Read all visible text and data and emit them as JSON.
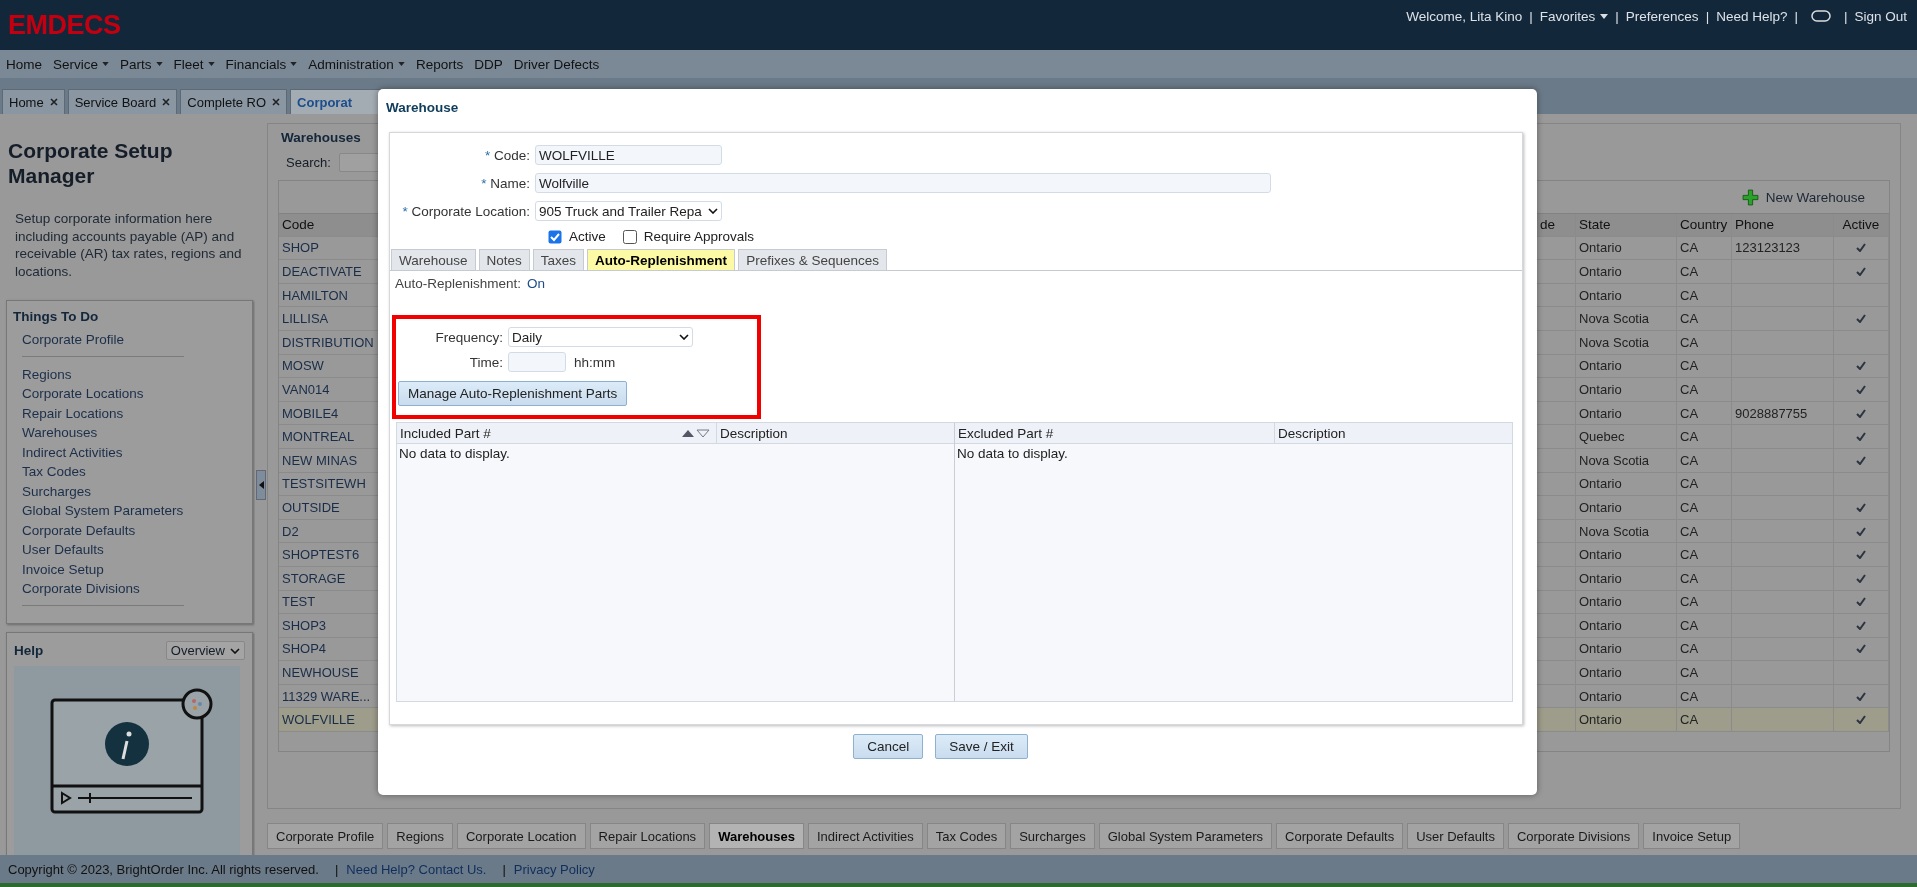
{
  "header": {
    "logo": "EMDECS",
    "items": [
      {
        "kind": "text",
        "label": "Welcome, Lita Kino"
      },
      {
        "kind": "sep",
        "label": "|"
      },
      {
        "kind": "dropdown",
        "label": "Favorites"
      },
      {
        "kind": "sep",
        "label": "|"
      },
      {
        "kind": "link",
        "label": "Preferences"
      },
      {
        "kind": "sep",
        "label": "|"
      },
      {
        "kind": "link",
        "label": "Need Help?"
      },
      {
        "kind": "sep",
        "label": "|"
      },
      {
        "kind": "icon"
      },
      {
        "kind": "sep",
        "label": "|"
      },
      {
        "kind": "link",
        "label": "Sign Out"
      }
    ]
  },
  "menu": [
    {
      "label": "Home",
      "dropdown": false
    },
    {
      "label": "Service",
      "dropdown": true
    },
    {
      "label": "Parts",
      "dropdown": true
    },
    {
      "label": "Fleet",
      "dropdown": true
    },
    {
      "label": "Financials",
      "dropdown": true
    },
    {
      "label": "Administration",
      "dropdown": true
    },
    {
      "label": "Reports",
      "dropdown": false
    },
    {
      "label": "DDP",
      "dropdown": false
    },
    {
      "label": "Driver Defects",
      "dropdown": false
    }
  ],
  "tabs": [
    {
      "label": "Home",
      "selected": false,
      "closable": true
    },
    {
      "label": "Service Board",
      "selected": false,
      "closable": true
    },
    {
      "label": "Complete RO",
      "selected": false,
      "closable": true
    },
    {
      "label": "Corporat",
      "selected": true,
      "closable": false
    }
  ],
  "sidebar": {
    "title": "Corporate Setup Manager",
    "description": "Setup corporate information here including accounts payable (AP) and receivable (AR) tax rates, regions and locations.",
    "things_to_do": {
      "title": "Things To Do",
      "groups": [
        [
          "Corporate Profile"
        ],
        [
          "Regions",
          "Corporate Locations",
          "Repair Locations",
          "Warehouses",
          "Indirect Activities",
          "Tax Codes",
          "Surcharges",
          "Global System Parameters",
          "Corporate Defaults",
          "User Defaults",
          "Invoice Setup",
          "Corporate Divisions"
        ]
      ]
    },
    "help": {
      "title": "Help",
      "dropdown": "Overview"
    }
  },
  "warehouses": {
    "title": "Warehouses",
    "search_label": "Search:",
    "new_button": "New Warehouse",
    "columns": [
      "Code",
      "de",
      "State",
      "Country",
      "Phone",
      "Active"
    ],
    "rows": [
      {
        "code": "SHOP",
        "state": "Ontario",
        "country": "CA",
        "phone": "123123123",
        "active": true,
        "selected": false
      },
      {
        "code": "DEACTIVATE",
        "state": "Ontario",
        "country": "CA",
        "active": true,
        "selected": false
      },
      {
        "code": "HAMILTON",
        "state": "Ontario",
        "country": "CA",
        "active": false,
        "selected": false
      },
      {
        "code": "LILLISA",
        "state": "Nova Scotia",
        "country": "CA",
        "active": true,
        "selected": false
      },
      {
        "code": "DISTRIBUTION",
        "state": "Nova Scotia",
        "country": "CA",
        "active": false,
        "selected": false
      },
      {
        "code": "MOSW",
        "state": "Ontario",
        "country": "CA",
        "active": true,
        "selected": false
      },
      {
        "code": "VAN014",
        "state": "Ontario",
        "country": "CA",
        "active": true,
        "selected": false
      },
      {
        "code": "MOBILE4",
        "state": "Ontario",
        "country": "CA",
        "phone": "9028887755",
        "active": true,
        "selected": false
      },
      {
        "code": "MONTREAL",
        "state": "Quebec",
        "country": "CA",
        "active": true,
        "selected": false
      },
      {
        "code": "NEW MINAS",
        "state": "Nova Scotia",
        "country": "CA",
        "active": true,
        "selected": false
      },
      {
        "code": "TESTSITEWH",
        "state": "Ontario",
        "country": "CA",
        "active": false,
        "selected": false
      },
      {
        "code": "OUTSIDE",
        "state": "Ontario",
        "country": "CA",
        "active": true,
        "selected": false
      },
      {
        "code": "D2",
        "state": "Nova Scotia",
        "country": "CA",
        "active": true,
        "selected": false
      },
      {
        "code": "SHOPTEST6",
        "state": "Ontario",
        "country": "CA",
        "active": true,
        "selected": false
      },
      {
        "code": "STORAGE",
        "state": "Ontario",
        "country": "CA",
        "active": true,
        "selected": false
      },
      {
        "code": "TEST",
        "state": "Ontario",
        "country": "CA",
        "active": true,
        "selected": false
      },
      {
        "code": "SHOP3",
        "state": "Ontario",
        "country": "CA",
        "active": true,
        "selected": false
      },
      {
        "code": "SHOP4",
        "state": "Ontario",
        "country": "CA",
        "active": true,
        "selected": false
      },
      {
        "code": "NEWHOUSE",
        "state": "Ontario",
        "country": "CA",
        "active": false,
        "selected": false
      },
      {
        "code": "11329 WARE...",
        "state": "Ontario",
        "country": "CA",
        "active": true,
        "selected": false
      },
      {
        "code": "WOLFVILLE",
        "state": "Ontario",
        "country": "CA",
        "active": true,
        "selected": true
      }
    ]
  },
  "bottom_tabs": [
    {
      "label": "Corporate Profile",
      "selected": false
    },
    {
      "label": "Regions",
      "selected": false
    },
    {
      "label": "Corporate Location",
      "selected": false
    },
    {
      "label": "Repair Locations",
      "selected": false
    },
    {
      "label": "Warehouses",
      "selected": true
    },
    {
      "label": "Indirect Activities",
      "selected": false
    },
    {
      "label": "Tax Codes",
      "selected": false
    },
    {
      "label": "Surcharges",
      "selected": false
    },
    {
      "label": "Global System Parameters",
      "selected": false
    },
    {
      "label": "Corporate Defaults",
      "selected": false
    },
    {
      "label": "User Defaults",
      "selected": false
    },
    {
      "label": "Corporate Divisions",
      "selected": false
    },
    {
      "label": "Invoice Setup",
      "selected": false
    }
  ],
  "footer": [
    {
      "kind": "text",
      "label": "Copyright © 2023, BrightOrder Inc. All rights reserved."
    },
    {
      "kind": "sep",
      "label": "|"
    },
    {
      "kind": "link",
      "label": "Need Help? Contact Us."
    },
    {
      "kind": "sep",
      "label": "|"
    },
    {
      "kind": "link",
      "label": "Privacy Policy"
    }
  ],
  "dialog": {
    "title": "Warehouse",
    "fields": [
      {
        "mark": "*",
        "label": "Code:",
        "kind": "input",
        "value": "WOLFVILLE",
        "wide": false
      },
      {
        "mark": "*",
        "label": "Name:",
        "kind": "input",
        "value": "Wolfville",
        "wide": true
      },
      {
        "mark": "*",
        "label": "Corporate Location:",
        "kind": "select",
        "value": "905 Truck and Trailer Repa",
        "wide": false
      }
    ],
    "checkboxes": [
      {
        "label": "Active",
        "checked": true
      },
      {
        "label": "Require Approvals",
        "checked": false
      }
    ],
    "tabs": [
      {
        "label": "Warehouse",
        "selected": false
      },
      {
        "label": "Notes",
        "selected": false
      },
      {
        "label": "Taxes",
        "selected": false
      },
      {
        "label": "Auto-Replenishment",
        "selected": true
      },
      {
        "label": "Prefixes & Sequences",
        "selected": false
      }
    ],
    "status": {
      "label": "Auto-Replenishment:",
      "value": "On"
    },
    "frequency": {
      "label": "Frequency:",
      "value": "Daily"
    },
    "time": {
      "label": "Time:",
      "hint": "hh:mm"
    },
    "manage_button": "Manage Auto-Replenishment Parts",
    "grids": [
      {
        "columns": [
          "Included Part #",
          "Description"
        ],
        "sortable": true,
        "empty_text": "No data to display."
      },
      {
        "columns": [
          "Excluded Part #",
          "Description"
        ],
        "sortable": false,
        "empty_text": "No data to display."
      }
    ],
    "buttons": [
      "Cancel",
      "Save / Exit"
    ]
  }
}
